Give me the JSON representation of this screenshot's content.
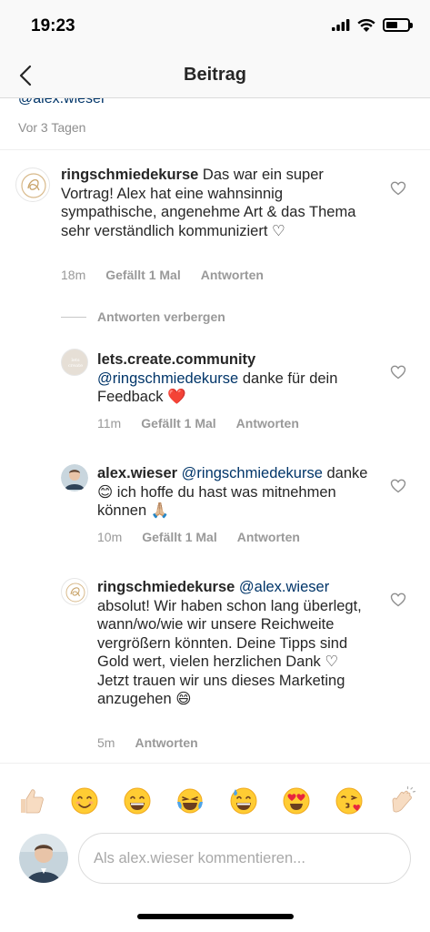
{
  "status_bar": {
    "time": "19:23",
    "battery_level": 0.55
  },
  "nav": {
    "title": "Beitrag"
  },
  "previous_comment": {
    "mention": "@alex.wieser",
    "time": "Vor 3 Tagen"
  },
  "comments": [
    {
      "username": "ringschmiedekurse",
      "text": " Das war ein super Vortrag! Alex hat eine wahnsinnig sympathische, angenehme Art & das Thema sehr verständlich kommuniziert ♡",
      "time": "18m",
      "likes": "Gefällt 1 Mal",
      "reply": "Antworten"
    }
  ],
  "replies_toggle": "Antworten verbergen",
  "replies": [
    {
      "username": "lets.create.community",
      "mention": "@ringschmiedekurse",
      "text": " danke für dein Feedback ❤️",
      "time": "11m",
      "likes": "Gefällt 1 Mal",
      "reply": "Antworten"
    },
    {
      "username": "alex.wieser",
      "mention": "@ringschmiedekurse",
      "text": " danke 😊 ich hoffe du hast was mitnehmen können 🙏🏼",
      "time": "10m",
      "likes": "Gefällt 1 Mal",
      "reply": "Antworten"
    },
    {
      "username": "ringschmiedekurse",
      "mention": "@alex.wieser",
      "text": " absolut! Wir haben schon lang überlegt, wann/wo/wie wir unsere Reichweite vergrößern könnten. Deine Tipps sind Gold wert, vielen herzlichen Dank ♡ Jetzt trauen wir uns dieses Marketing anzugehen 😄",
      "time": "5m",
      "reply": "Antworten"
    }
  ],
  "emoji_bar": [
    "👍🏻",
    "😊",
    "😄",
    "😂",
    "😅",
    "😍",
    "😘",
    "👏🏻"
  ],
  "composer": {
    "placeholder": "Als alex.wieser kommentieren..."
  },
  "colors": {
    "mention": "#003569",
    "meta": "#999999",
    "text": "#262626"
  }
}
